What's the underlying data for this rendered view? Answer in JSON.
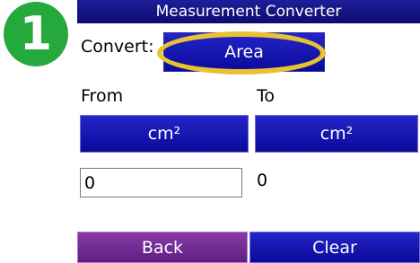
{
  "step": {
    "number": "1",
    "color": "#25a83c"
  },
  "header": {
    "title": "Measurement Converter"
  },
  "convert": {
    "label": "Convert:",
    "value": "Area",
    "highlight_color": "#e8c232"
  },
  "from": {
    "label": "From",
    "unit": "cm²",
    "value": "0"
  },
  "to": {
    "label": "To",
    "unit": "cm²",
    "value": "0"
  },
  "footer": {
    "back_label": "Back",
    "clear_label": "Clear"
  },
  "colors": {
    "title_bar": "#1e1e9a",
    "button_blue": "#1616b4",
    "back_purple": "#7a2e98"
  }
}
